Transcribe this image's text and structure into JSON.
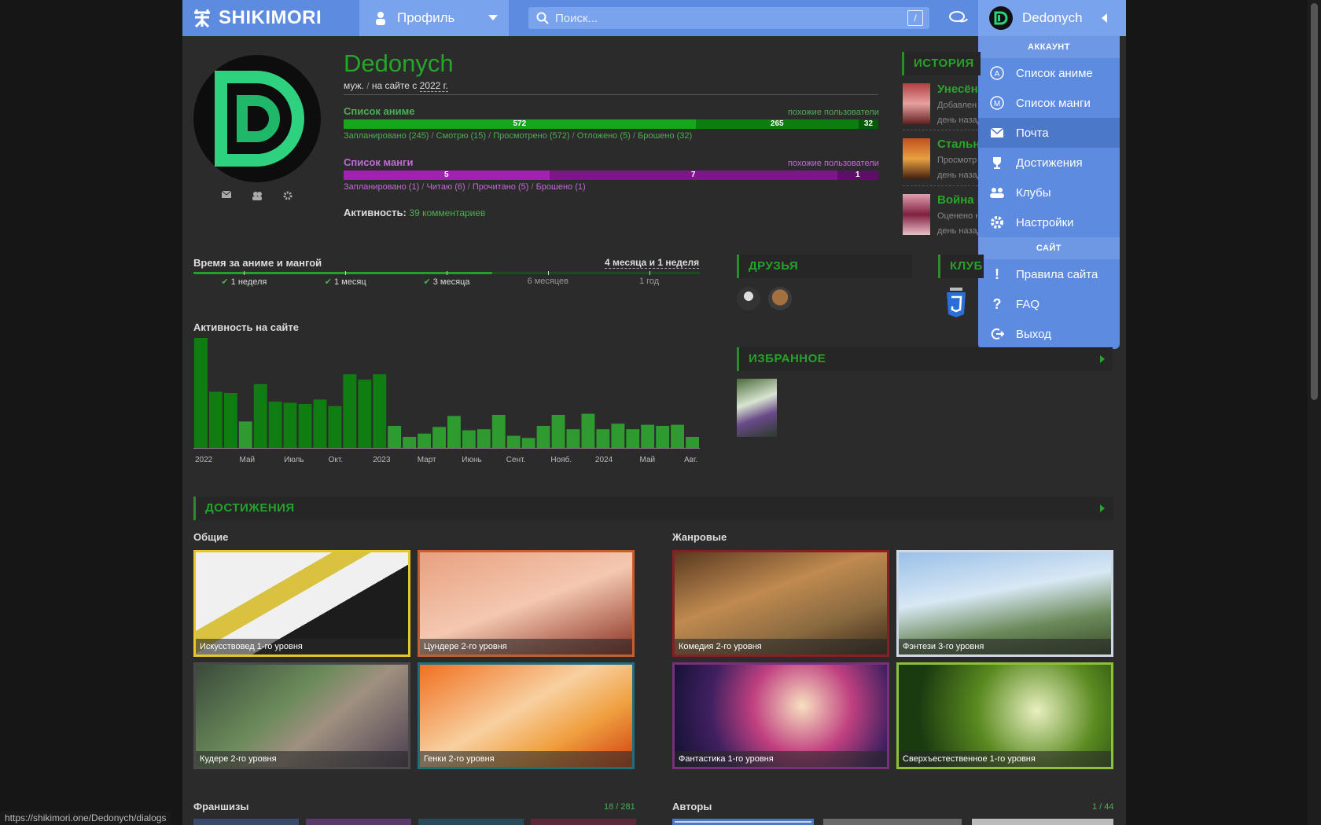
{
  "header": {
    "logo_text": "SHIKIMORI",
    "profile_label": "Профиль",
    "search_placeholder": "Поиск...",
    "search_hotkey": "/",
    "user_name": "Dedonych"
  },
  "dropdown": {
    "account_header": "АККАУНТ",
    "account_items": [
      {
        "label": "Список аниме",
        "icon": "anime-list-icon"
      },
      {
        "label": "Список манги",
        "icon": "manga-list-icon"
      },
      {
        "label": "Почта",
        "icon": "mail-icon"
      },
      {
        "label": "Достижения",
        "icon": "trophy-icon"
      },
      {
        "label": "Клубы",
        "icon": "clubs-icon"
      },
      {
        "label": "Настройки",
        "icon": "gear-icon"
      }
    ],
    "site_header": "САЙТ",
    "site_items": [
      {
        "label": "Правила сайта",
        "icon": "exclamation-icon"
      },
      {
        "label": "FAQ",
        "icon": "question-icon"
      },
      {
        "label": "Выход",
        "icon": "logout-icon"
      }
    ]
  },
  "profile": {
    "name": "Dedonych",
    "gender": "муж.",
    "since_prefix": "на сайте с",
    "since_year": "2022 г.",
    "anime_list_title": "Список аниме",
    "similar_users": "похожие пользователи",
    "anime_bar": [
      572,
      265,
      32
    ],
    "anime_stats": [
      "Запланировано (245)",
      "Смотрю (15)",
      "Просмотрено (572)",
      "Отложено (5)",
      "Брошено (32)"
    ],
    "manga_list_title": "Список манги",
    "manga_bar": [
      5,
      7,
      1
    ],
    "manga_stats": [
      "Запланировано (1)",
      "Читаю (6)",
      "Прочитано (5)",
      "Брошено (1)"
    ],
    "activity_label": "Активность:",
    "activity_value": "39 комментариев"
  },
  "time_spent": {
    "title": "Время за аниме и мангой",
    "total": "4 месяца и 1 неделя",
    "progress": 0.59,
    "marks": [
      "1 неделя",
      "1 месяц",
      "3 месяца",
      "6 месяцев",
      "1 год"
    ],
    "reached": [
      true,
      true,
      true,
      false,
      false
    ]
  },
  "activity_chart": {
    "title": "Активность на сайте"
  },
  "chart_data": {
    "type": "bar",
    "title": "Активность на сайте",
    "x_tick_labels": [
      "2022",
      "Май",
      "Июль",
      "Окт.",
      "2023",
      "Март",
      "Июнь",
      "Сент.",
      "Нояб.",
      "2024",
      "Май",
      "Авг."
    ],
    "values": [
      100,
      51,
      50,
      24,
      58,
      42,
      41,
      40,
      44,
      38,
      67,
      62,
      67,
      20,
      10,
      13,
      19,
      29,
      16,
      17,
      30,
      11,
      9,
      20,
      30,
      17,
      31,
      17,
      22,
      17,
      21,
      20,
      21,
      10
    ],
    "colors": {
      "high": "#0f7d12",
      "low": "#2f9a2f"
    }
  },
  "history": {
    "title": "ИСТОРИЯ",
    "items": [
      {
        "title": "Унесённ",
        "sub1": "Добавлен",
        "sub2": "день назад"
      },
      {
        "title": "Стальн",
        "sub1": "Просмотр",
        "sub2": "день назад"
      },
      {
        "title": "Война п",
        "sub1": "Оценено н",
        "sub2": "день назад"
      }
    ]
  },
  "friends": {
    "title": "ДРУЗЬЯ"
  },
  "clubs": {
    "title": "КЛУБ"
  },
  "favorites": {
    "title": "ИЗБРАННОЕ"
  },
  "achievements": {
    "title": "ДОСТИЖЕНИЯ",
    "general_title": "Общие",
    "genre_title": "Жанровые",
    "general": [
      {
        "label": "Искусствовед 1-го уровня",
        "border": "#e6c72a"
      },
      {
        "label": "Цундере 2-го уровня",
        "border": "#c4602c"
      },
      {
        "label": "Кудере 2-го уровня",
        "border": "#4a4a4a"
      },
      {
        "label": "Генки 2-го уровня",
        "border": "#1d6f7f"
      }
    ],
    "genre": [
      {
        "label": "Комедия 2-го уровня",
        "border": "#8a1f1f"
      },
      {
        "label": "Фэнтези 3-го уровня",
        "border": "#cfd8e6"
      },
      {
        "label": "Фантастика 1-го уровня",
        "border": "#7a2f7a"
      },
      {
        "label": "Сверхъестественное 1-го уровня",
        "border": "#8cc23a"
      }
    ]
  },
  "franchises": {
    "title": "Франшизы",
    "count": "18 / 281"
  },
  "authors": {
    "title": "Авторы",
    "count": "1 / 44"
  },
  "statusbar": {
    "url": "https://shikimori.one/Dedonych/dialogs"
  }
}
